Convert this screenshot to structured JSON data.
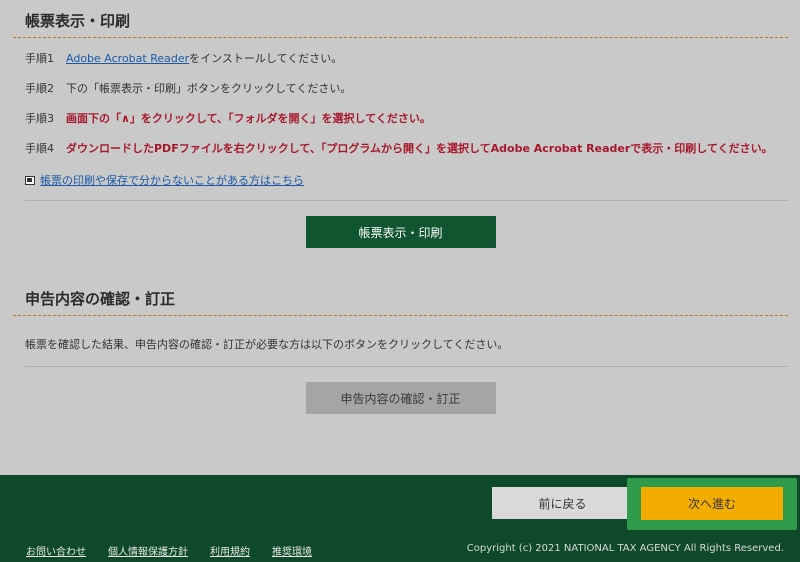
{
  "section1": {
    "title": "帳票表示・印刷",
    "steps": [
      {
        "num": "手順1",
        "link": "Adobe Acrobat Reader",
        "text": "をインストールしてください。"
      },
      {
        "num": "手順2",
        "text": "下の「帳票表示・印刷」ボタンをクリックしてください。"
      },
      {
        "num": "手順3",
        "text": "画面下の「∧」をクリックして、「フォルダを開く」を選択してください。"
      },
      {
        "num": "手順4",
        "text": "ダウンロードしたPDFファイルを右クリックして、「プログラムから開く」を選択してAdobe Acrobat Readerで表示・印刷してください。"
      }
    ],
    "help_link": "帳票の印刷や保存で分からないことがある方はこちら",
    "button": "帳票表示・印刷"
  },
  "section2": {
    "title": "申告内容の確認・訂正",
    "description": "帳票を確認した結果、申告内容の確認・訂正が必要な方は以下のボタンをクリックしてください。",
    "button": "申告内容の確認・訂正"
  },
  "footer": {
    "back_button": "前に戻る",
    "next_button": "次へ進む",
    "links": [
      "お問い合わせ",
      "個人情報保護方針",
      "利用規約",
      "推奨環境"
    ],
    "copyright": "Copyright (c) 2021 NATIONAL TAX AGENCY All Rights Reserved."
  },
  "colors": {
    "primary_green": "#0e5530",
    "footer_green": "#0e4a2a",
    "highlight_green": "#2f9a4a",
    "next_yellow": "#f2ad00",
    "warning_red": "#a8182c",
    "link_blue": "#1a5aa8"
  }
}
